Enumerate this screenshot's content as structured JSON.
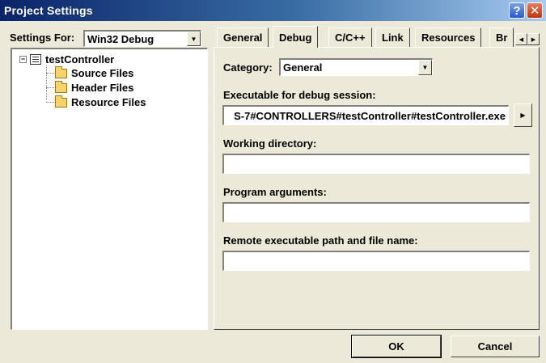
{
  "window": {
    "title": "Project Settings",
    "help_glyph": "?",
    "close_glyph": "✕"
  },
  "left": {
    "settings_for_label": "Settings For:",
    "settings_for_value": "Win32 Debug",
    "tree": {
      "project": "testController",
      "folders": [
        "Source Files",
        "Header Files",
        "Resource Files"
      ]
    }
  },
  "tabs": [
    "General",
    "Debug",
    "C/C++",
    "Link",
    "Resources",
    "Br"
  ],
  "active_tab": "Debug",
  "debug": {
    "category_label": "Category:",
    "category_value": "General",
    "executable_label": "Executable for debug session:",
    "executable_value": "S-7#CONTROLLERS#testController#testController.exe",
    "working_dir_label": "Working directory:",
    "working_dir_value": "",
    "program_args_label": "Program arguments:",
    "program_args_value": "",
    "remote_label": "Remote executable path and file name:",
    "remote_value": ""
  },
  "buttons": {
    "ok": "OK",
    "cancel": "Cancel"
  },
  "icons": {
    "dropdown": "dropdown-arrow-icon",
    "folder": "folder-icon",
    "project": "project-icon"
  }
}
